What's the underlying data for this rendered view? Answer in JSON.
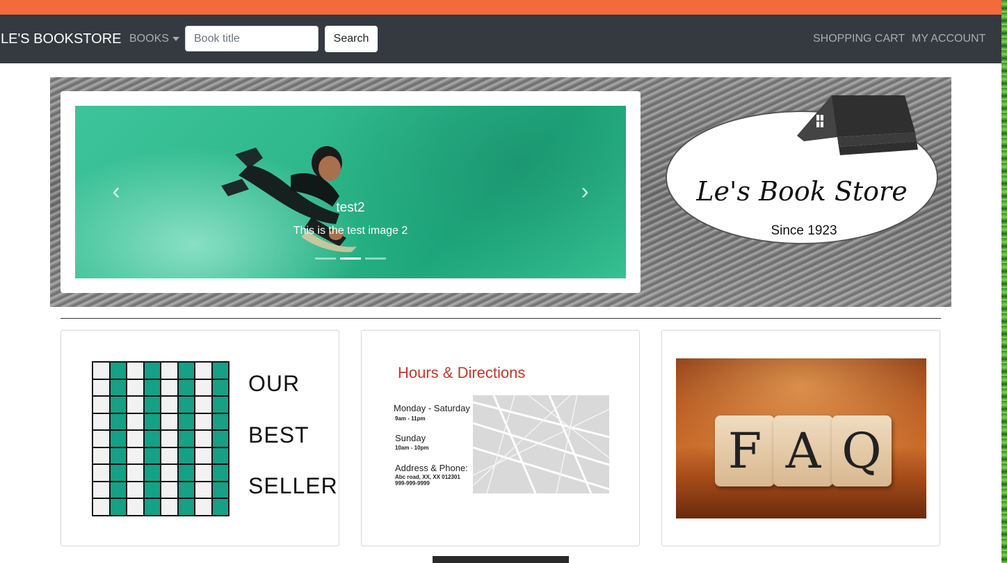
{
  "navbar": {
    "brand": "LE'S BOOKSTORE",
    "books_label": "BOOKS",
    "search_placeholder": "Book title",
    "search_button": "Search",
    "cart_label": "SHOPPING CART",
    "account_label": "MY ACCOUNT"
  },
  "hero": {
    "slide": {
      "title": "test2",
      "caption": "This is the test image 2"
    },
    "indicator_count": 3,
    "active_indicator": 2,
    "logo": {
      "name": "Le's Book Store",
      "since": "Since 1923"
    }
  },
  "cards": {
    "best_seller": {
      "lines": [
        "OUR",
        "BEST",
        "SELLER"
      ]
    },
    "hours": {
      "title": "Hours & Directions",
      "entries": [
        {
          "label": "Monday - Saturday",
          "value": "9am - 11pm"
        },
        {
          "label": "Sunday",
          "value": "10am - 10pm"
        },
        {
          "label": "Address & Phone:",
          "value": "Abc road, XX, XX 012301",
          "value2": "999-999-9999"
        }
      ]
    },
    "faq": {
      "letters": [
        "F",
        "A",
        "Q"
      ]
    }
  },
  "colors": {
    "accent_bar": "#f26b3a",
    "navbar": "#343a40",
    "hours_title": "#c0392b"
  }
}
